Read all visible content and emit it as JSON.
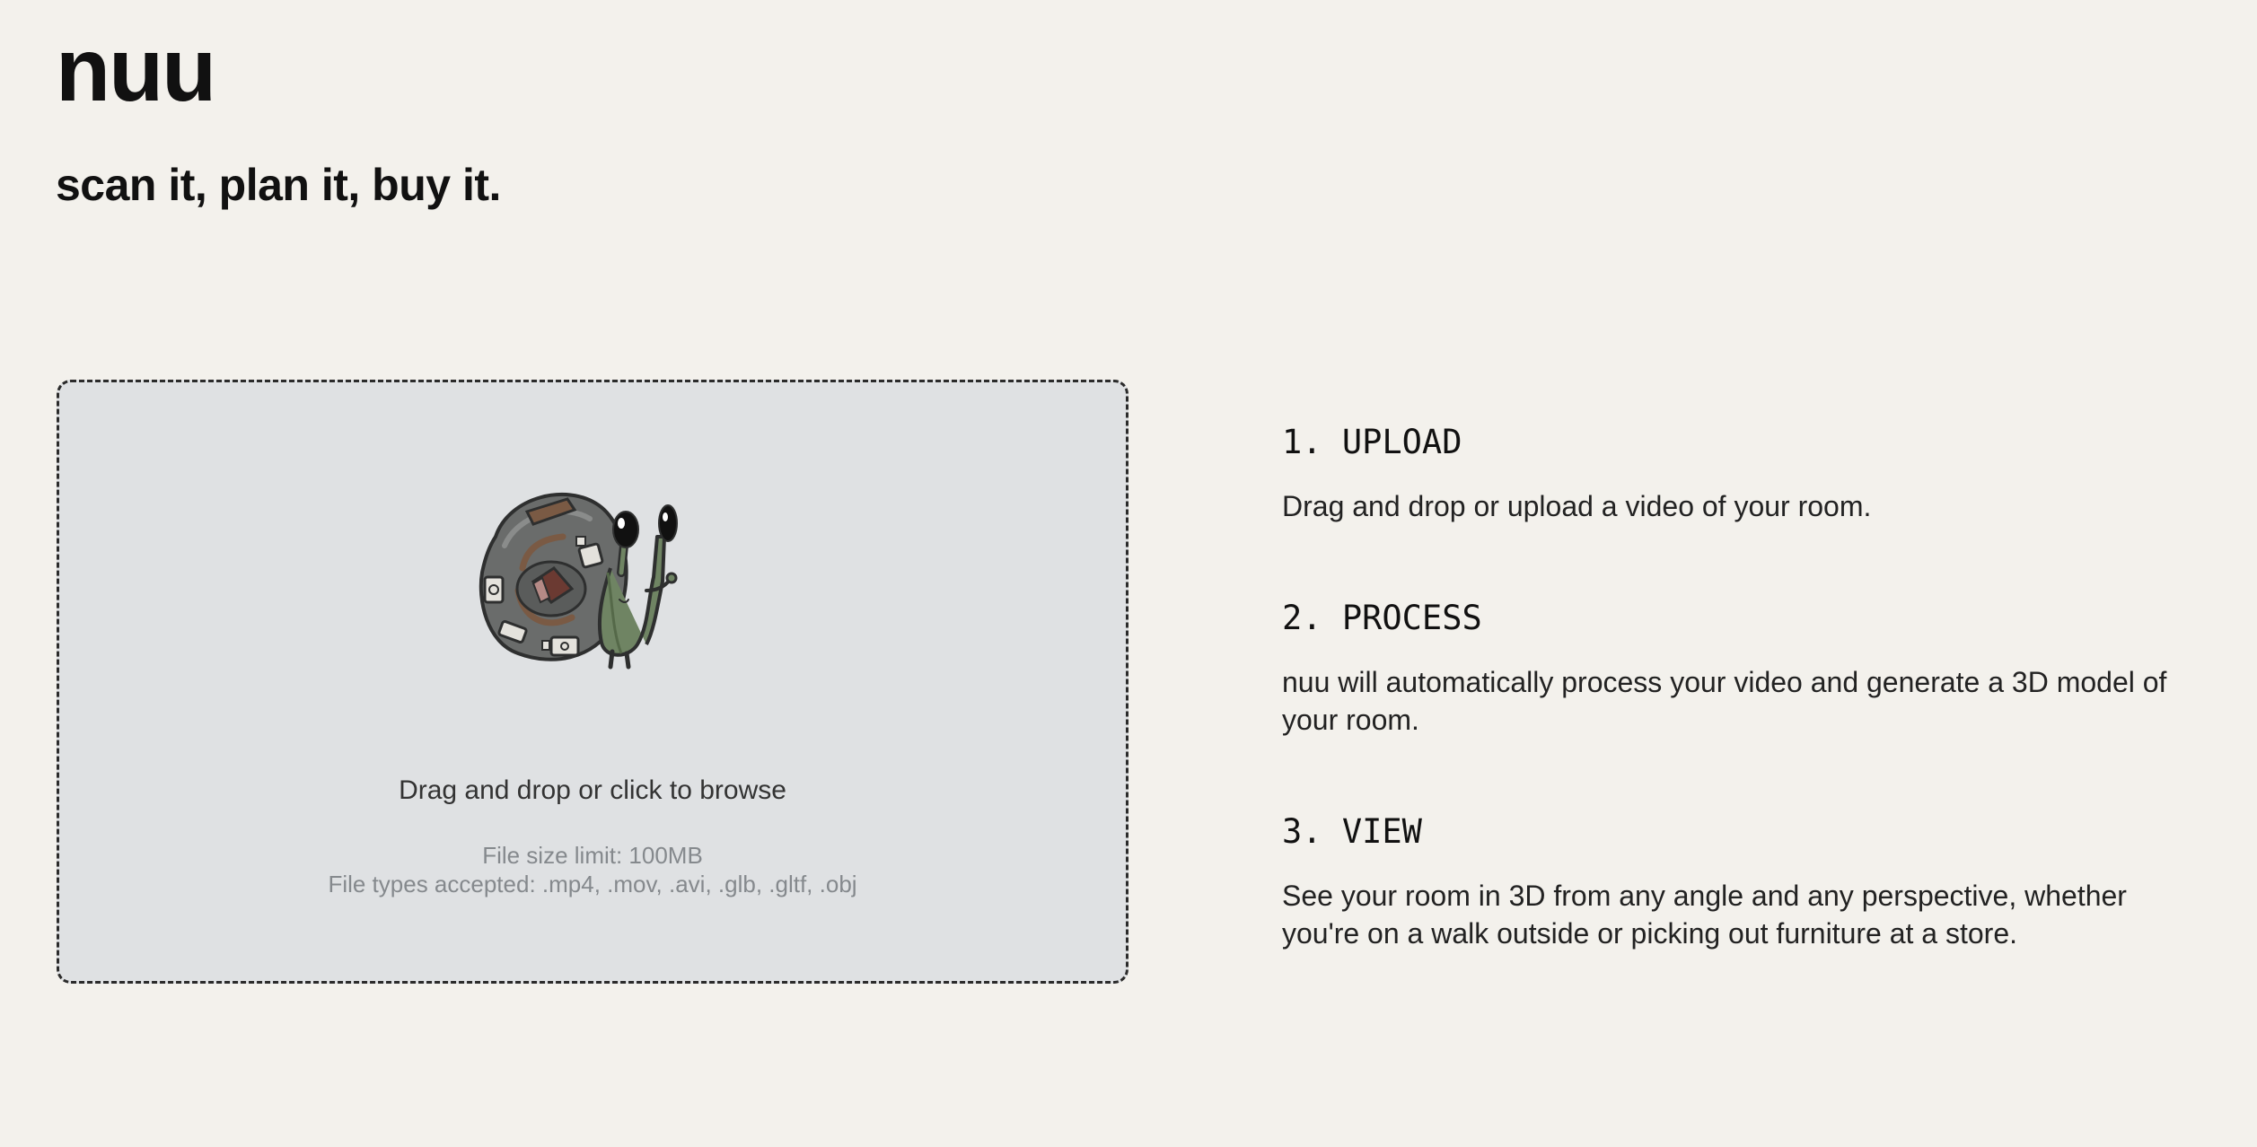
{
  "brand": {
    "name": "nuu",
    "tagline": "scan it, plan it, buy it."
  },
  "upload": {
    "prompt": "Drag and drop or click to browse",
    "size_limit": "File size limit: 100MB",
    "types": "File types accepted: .mp4, .mov, .avi, .glb, .gltf, .obj",
    "illustration_icon": "snail-room-mascot-icon"
  },
  "steps": [
    {
      "title": "1. UPLOAD",
      "description": "Drag and drop or upload a video of your room."
    },
    {
      "title": "2. PROCESS",
      "description": "nuu will automatically process your video and generate a 3D model of your room."
    },
    {
      "title": "3. VIEW",
      "description": "See your room in 3D from any angle and any perspective, whether you're on a walk outside or picking out furniture at a store."
    }
  ],
  "colors": {
    "background": "#f3f1ec",
    "dropzone_fill": "#dfe1e3",
    "dropzone_border": "#2b2b2b",
    "muted_text": "#85898d"
  }
}
